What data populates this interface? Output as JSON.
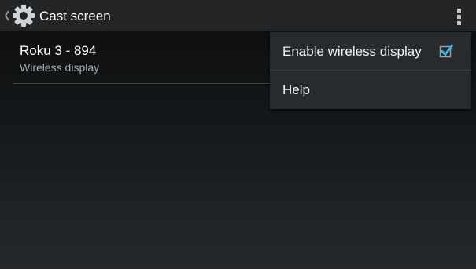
{
  "action_bar": {
    "title": "Cast screen",
    "up_icon": "chevron-left-icon",
    "app_icon": "gear-icon",
    "overflow_icon": "overflow-menu-icon"
  },
  "devices": [
    {
      "name": "Roku 3 - 894",
      "summary": "Wireless display"
    }
  ],
  "overflow_menu": {
    "items": [
      {
        "label": "Enable wireless display",
        "checked": true
      },
      {
        "label": "Help"
      }
    ]
  },
  "colors": {
    "accent": "#33b5e5",
    "action_bar": "#222426",
    "menu_background": "#282b2d"
  }
}
